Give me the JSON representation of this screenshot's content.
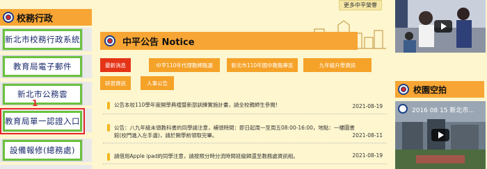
{
  "left": {
    "title": "校務行政",
    "buttons": [
      {
        "label": "新北市校務行政系統"
      },
      {
        "label": "教育局電子郵件"
      },
      {
        "label": "新北市公務雲"
      },
      {
        "label": "教育局單一認證入口"
      },
      {
        "label": "設備報修(總務處)"
      }
    ],
    "marker": "1"
  },
  "center": {
    "more_label": "更多中平榮譽",
    "notice_title": "中平公告 Notice",
    "tabs": [
      {
        "label": "最新消息",
        "active": true
      },
      {
        "label": "中平110年代理教師甄選"
      },
      {
        "label": "新北市110年國中教甄專區"
      },
      {
        "label": "九年級升學資訊"
      },
      {
        "label": "研習資訊"
      },
      {
        "label": "人事公告"
      }
    ],
    "items": [
      {
        "text": "公告本校110學年度開學典禮暨新部訓練實施計畫，請全校親師生參閱!",
        "date": "2021-08-19"
      },
      {
        "text": "公告：八九年級未領教科書的同學請注意，補領時間：即日起周一至周五08:00-16:00，地點：一樓圖書館(校門進入左手邊)，請於開學前領取完畢。",
        "date": "2021-08-11"
      },
      {
        "text": "請借用Apple ipad的同學注意，請按照分時分流時間班級歸還至教務處資訊組。",
        "date": "2021-08-19"
      }
    ]
  },
  "right": {
    "campus_title": "校園空拍",
    "video2_title": "2016 08 15 新北市..."
  },
  "colors": {
    "header_orange": "#f7a534",
    "active_tab": "#e53317",
    "tab": "#f5a229",
    "button_border": "#6ac13f",
    "highlight": "#e8242a"
  }
}
